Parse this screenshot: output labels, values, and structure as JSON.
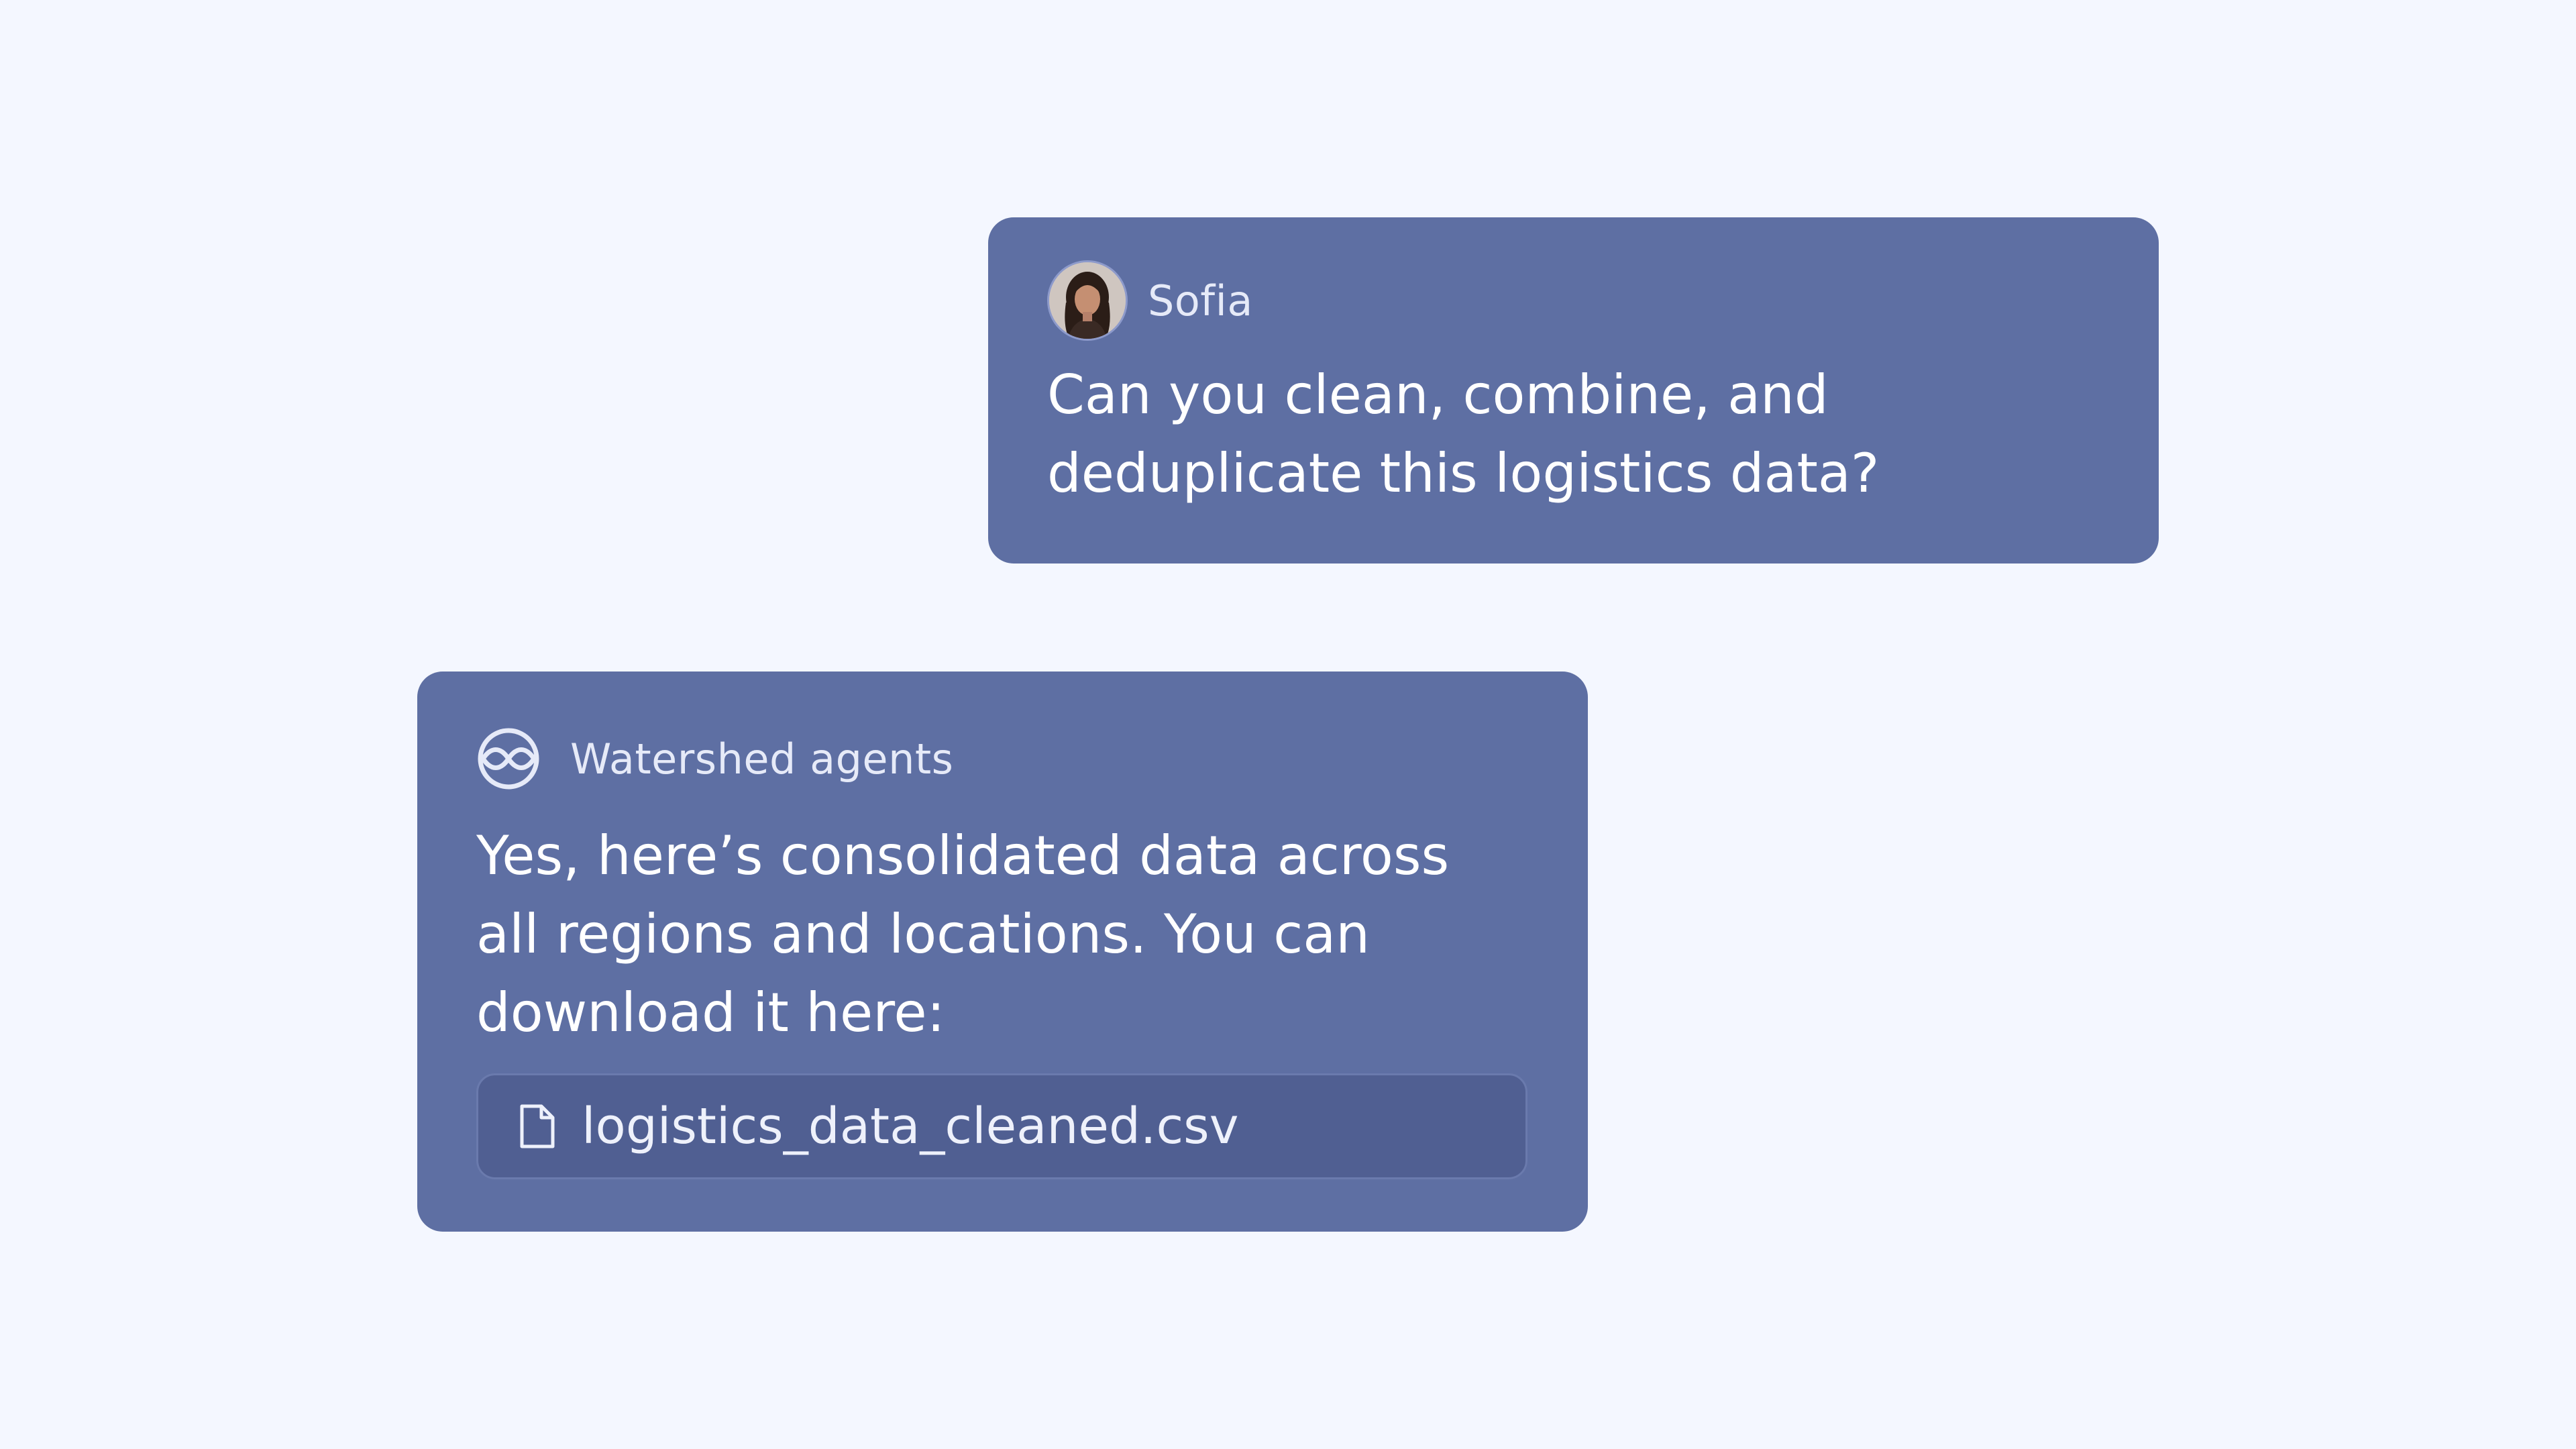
{
  "conversation": {
    "messages": [
      {
        "sender": "Sofia",
        "avatar_icon": "user-avatar",
        "text": "Can you clean, combine,  and\ndeduplicate this logistics data?"
      },
      {
        "sender": "Watershed agents",
        "avatar_icon": "watershed-logo-icon",
        "text": "Yes, here’s consolidated data across\nall regions and locations. You can\ndownload it here:",
        "attachment": {
          "icon": "file-icon",
          "file_name": "logistics_data_cleaned.csv"
        }
      }
    ]
  },
  "colors": {
    "background": "#f4f7ff",
    "bubble": "#5e6fa3",
    "attachment_bg": "#505f92",
    "text": "#ffffff"
  }
}
